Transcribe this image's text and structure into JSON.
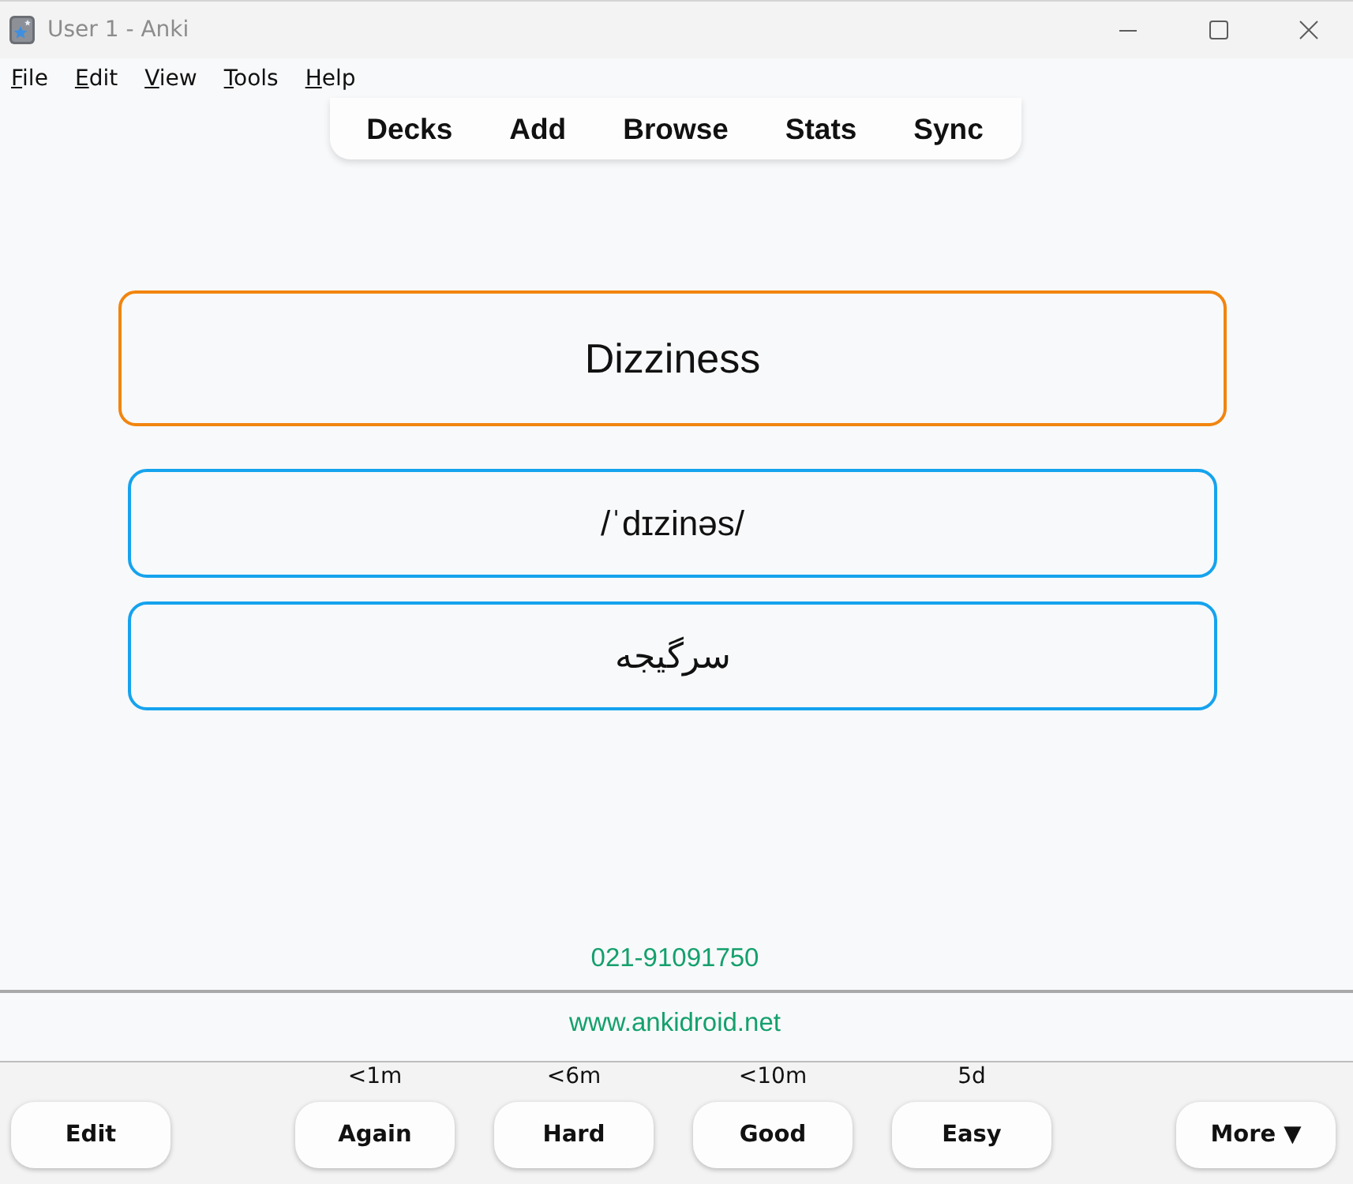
{
  "window": {
    "title": "User 1 - Anki"
  },
  "menu": [
    "File",
    "Edit",
    "View",
    "Tools",
    "Help"
  ],
  "toolbar": [
    "Decks",
    "Add",
    "Browse",
    "Stats",
    "Sync"
  ],
  "card": {
    "front": "Dizziness",
    "fields": [
      "/ˈdɪzinəs/",
      "سرگیجه"
    ],
    "phone": "021-91091750",
    "website": "www.ankidroid.net"
  },
  "answer_bar": {
    "edit": "Edit",
    "answers": [
      {
        "label": "Again",
        "interval": "<1m"
      },
      {
        "label": "Hard",
        "interval": "<6m"
      },
      {
        "label": "Good",
        "interval": "<10m"
      },
      {
        "label": "Easy",
        "interval": "5d"
      }
    ],
    "more": "More ▼"
  }
}
